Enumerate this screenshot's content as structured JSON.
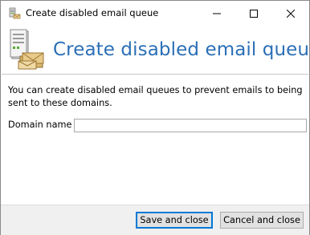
{
  "window": {
    "title": "Create disabled email queue",
    "app_icon": "email-server-icon",
    "controls": {
      "minimize_icon": "minimize-icon",
      "maximize_icon": "maximize-icon",
      "close_icon": "close-icon"
    }
  },
  "header": {
    "icon": "email-server-icon",
    "title": "Create disabled email queue"
  },
  "body": {
    "description": "You can create disabled email queues to prevent emails to being sent to these domains.",
    "domain_field": {
      "label": "Domain name",
      "value": "",
      "placeholder": ""
    }
  },
  "footer": {
    "save_label": "Save and close",
    "cancel_label": "Cancel and close"
  },
  "colors": {
    "header_title": "#2b6fb6",
    "footer_background": "#f0f0f0",
    "default_button_border": "#0078d7"
  }
}
